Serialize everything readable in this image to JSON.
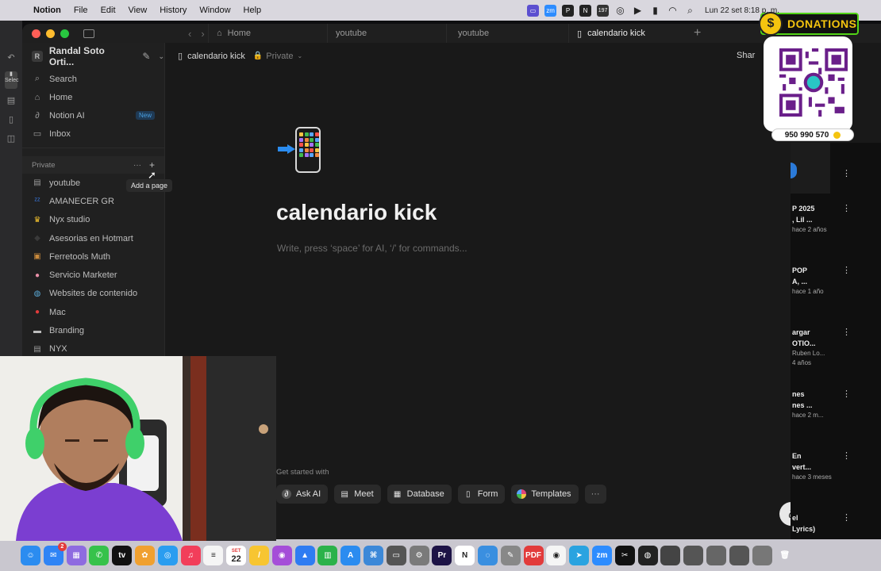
{
  "menubar": {
    "app_name": "Notion",
    "menus": [
      "File",
      "Edit",
      "View",
      "History",
      "Window",
      "Help"
    ],
    "status_icons": [
      "display-icon",
      "zoom-icon",
      "pdf-icon",
      "notion-icon",
      "notification-badge-icon",
      "airdrop-icon",
      "play-icon",
      "battery-icon",
      "wifi-icon",
      "search-icon"
    ],
    "notification_count": "197",
    "clock": "Lun 22 set  8:18 p. m."
  },
  "tabs": [
    {
      "label": "Home",
      "icon": "home-icon"
    },
    {
      "label": "youtube",
      "icon": ""
    },
    {
      "label": "youtube",
      "icon": ""
    },
    {
      "label": "calendario kick",
      "icon": "phone-icon"
    }
  ],
  "sidebar": {
    "workspace_initial": "R",
    "workspace_name": "Randal Soto Orti...",
    "nav": [
      {
        "label": "Search",
        "icon": "search-icon",
        "glyph": "⌕"
      },
      {
        "label": "Home",
        "icon": "home-icon",
        "glyph": "⌂"
      },
      {
        "label": "Notion AI",
        "icon": "notion-ai-icon",
        "glyph": "∂",
        "badge": "New"
      },
      {
        "label": "Inbox",
        "icon": "inbox-icon",
        "glyph": "▭"
      }
    ],
    "section_title": "Private",
    "tooltip": "Add a page",
    "pages": [
      {
        "label": "youtube",
        "icon": "page-icon",
        "glyph": "▤",
        "color": "#9a9a9a"
      },
      {
        "label": "AMANECER GR",
        "icon": "zzz-icon",
        "glyph": "ᶻᶻ",
        "color": "#3b82f6"
      },
      {
        "label": "Nyx studio",
        "icon": "crown-icon",
        "glyph": "♛",
        "color": "#f2c12e"
      },
      {
        "label": "Asesorias en Hotmart",
        "icon": "ninja-icon",
        "glyph": "◆",
        "color": "#3a3a3a"
      },
      {
        "label": "Ferretools Muth",
        "icon": "box-icon",
        "glyph": "▣",
        "color": "#c98a3c"
      },
      {
        "label": "Servicio Marketer",
        "icon": "brain-icon",
        "glyph": "●",
        "color": "#e98fa8"
      },
      {
        "label": "Websites de contenido",
        "icon": "globe-icon",
        "glyph": "◍",
        "color": "#5aa9d6"
      },
      {
        "label": "Mac",
        "icon": "apple-icon",
        "glyph": "●",
        "color": "#e23b3b"
      },
      {
        "label": "Branding",
        "icon": "laptop-icon",
        "glyph": "▬",
        "color": "#bbbbbb"
      },
      {
        "label": "NYX",
        "icon": "page-icon",
        "glyph": "▤",
        "color": "#9a9a9a"
      }
    ]
  },
  "page": {
    "breadcrumb": "calendario kick",
    "privacy": "Private",
    "share": "Shar",
    "title": "calendario kick",
    "placeholder": "Write, press ‘space’ for AI, ‘/’ for commands...",
    "get_started": "Get started with",
    "actions": [
      {
        "label": "Ask AI",
        "icon": "notion-ai-icon",
        "glyph": "∂",
        "color": "#555"
      },
      {
        "label": "Meet",
        "icon": "meet-icon",
        "glyph": "▤",
        "color": "transparent"
      },
      {
        "label": "Database",
        "icon": "database-icon",
        "glyph": "▦",
        "color": "transparent"
      },
      {
        "label": "Form",
        "icon": "form-icon",
        "glyph": "▯",
        "color": "transparent"
      },
      {
        "label": "Templates",
        "icon": "templates-icon",
        "glyph": "●",
        "color": "#e0457b"
      }
    ],
    "more": "···"
  },
  "youtube_panel": [
    {
      "line1": "P 2025",
      "line2": ", Lil ...",
      "line3": "hace 2 años"
    },
    {
      "line1": "POP",
      "line2": "A, ...",
      "line3": "hace 1 año"
    },
    {
      "line1": "argar",
      "line2": "OTIO...",
      "line3": "Ruben Lo...",
      "line4": "4 años"
    },
    {
      "line1": "nes",
      "line2": "nes ...",
      "line3": "hace 2 m..."
    },
    {
      "line1": "En",
      "line2": "vert...",
      "line3": "hace 3 meses"
    },
    {
      "line1": "el",
      "line2": "Lyrics)",
      "line3": ""
    }
  ],
  "donations": {
    "title": "DONATIONS",
    "coin": "$",
    "qr_brand": "yape",
    "phone": "950 990 570"
  },
  "dock": {
    "calendar_month": "SET",
    "calendar_day": "22",
    "mail_badge": "2",
    "apps": [
      {
        "name": "finder-icon",
        "color": "#2b8cf0",
        "glyph": "☺"
      },
      {
        "name": "mail-icon",
        "color": "#2f84f5",
        "glyph": "✉"
      },
      {
        "name": "launchpad-icon",
        "color": "#8e6be0",
        "glyph": "▦"
      },
      {
        "name": "messages-icon",
        "color": "#36c24a",
        "glyph": "✆"
      },
      {
        "name": "apple-tv-icon",
        "color": "#111",
        "glyph": "tv"
      },
      {
        "name": "photos-icon",
        "color": "#f0a030",
        "glyph": "✿"
      },
      {
        "name": "safari-icon",
        "color": "#2a9df0",
        "glyph": "◎"
      },
      {
        "name": "music-icon",
        "color": "#f23e5a",
        "glyph": "♫"
      },
      {
        "name": "reminders-icon",
        "color": "#f5f5f5",
        "glyph": "≡"
      },
      {
        "name": "calendar-icon",
        "color": "#ffffff",
        "glyph": ""
      },
      {
        "name": "notes-icon",
        "color": "#f7c531",
        "glyph": "/"
      },
      {
        "name": "podcasts-icon",
        "color": "#a54ed8",
        "glyph": "◉"
      },
      {
        "name": "keynote-icon",
        "color": "#2f7cf2",
        "glyph": "▲"
      },
      {
        "name": "numbers-icon",
        "color": "#2bb24a",
        "glyph": "▥"
      },
      {
        "name": "app-store-icon",
        "color": "#2b8cf0",
        "glyph": "A"
      },
      {
        "name": "preview-icon",
        "color": "#3c88d8",
        "glyph": "⌘"
      },
      {
        "name": "screenshot-icon",
        "color": "#555",
        "glyph": "▭"
      },
      {
        "name": "settings-icon",
        "color": "#7a7a7a",
        "glyph": "⚙"
      },
      {
        "name": "premiere-icon",
        "color": "#1d1346",
        "glyph": "Pr"
      },
      {
        "name": "notion-icon",
        "color": "#ffffff",
        "glyph": "N"
      },
      {
        "name": "finder-search-icon",
        "color": "#3a8fe0",
        "glyph": "◌"
      },
      {
        "name": "pen-icon",
        "color": "#888",
        "glyph": "✎"
      },
      {
        "name": "pdf-icon",
        "color": "#e23b3b",
        "glyph": "PDF"
      },
      {
        "name": "chrome-icon",
        "color": "#f5f5f5",
        "glyph": "◉"
      },
      {
        "name": "telegram-icon",
        "color": "#2aa3e0",
        "glyph": "➤"
      },
      {
        "name": "zoom-icon",
        "color": "#2d8cff",
        "glyph": "zm"
      },
      {
        "name": "capcut-icon",
        "color": "#111",
        "glyph": "✂"
      },
      {
        "name": "obs-icon",
        "color": "#222",
        "glyph": "◍"
      },
      {
        "name": "recent-window-1",
        "color": "#444",
        "glyph": ""
      },
      {
        "name": "recent-window-2",
        "color": "#555",
        "glyph": ""
      },
      {
        "name": "recent-window-3",
        "color": "#666",
        "glyph": ""
      },
      {
        "name": "recent-window-4",
        "color": "#555",
        "glyph": ""
      },
      {
        "name": "recent-window-5",
        "color": "#777",
        "glyph": ""
      },
      {
        "name": "trash-icon",
        "color": "transparent",
        "glyph": "🗑"
      }
    ]
  }
}
